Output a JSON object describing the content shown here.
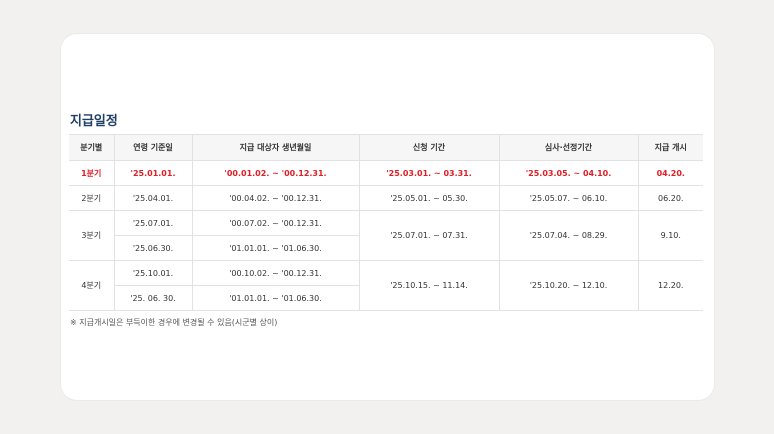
{
  "section_title": "지급일정",
  "table": {
    "headers": [
      "분기별",
      "연령 기준일",
      "지급 대상자 생년월일",
      "신청 기간",
      "심사·선정기간",
      "지급 개시"
    ],
    "q1": {
      "quarter": "1분기",
      "base_date": "'25.01.01.",
      "birth": "'00.01.02. ~ '00.12.31.",
      "apply": "'25.03.01. ~ 03.31.",
      "review": "'25.03.05. ~ 04.10.",
      "start": "04.20."
    },
    "q2": {
      "quarter": "2분기",
      "base_date": "'25.04.01.",
      "birth": "'00.04.02. ~ '00.12.31.",
      "apply": "'25.05.01. ~ 05.30.",
      "review": "'25.05.07. ~ 06.10.",
      "start": "06.20."
    },
    "q3": {
      "quarter": "3분기",
      "base_date_1": "'25.07.01.",
      "birth_1": "'00.07.02. ~ '00.12.31.",
      "base_date_2": "'25.06.30.",
      "birth_2": "'01.01.01. ~ '01.06.30.",
      "apply": "'25.07.01. ~ 07.31.",
      "review": "'25.07.04. ~ 08.29.",
      "start": "9.10."
    },
    "q4": {
      "quarter": "4분기",
      "base_date_1": "'25.10.01.",
      "birth_1": "'00.10.02. ~ '00.12.31.",
      "base_date_2": "'25. 06. 30.",
      "birth_2": "'01.01.01. ~ '01.06.30.",
      "apply": "'25.10.15. ~ 11.14.",
      "review": "'25.10.20. ~ 12.10.",
      "start": "12.20."
    }
  },
  "note": "※ 지급개시일은 부득이한 경우에 변경될 수 있음(시군별 상이)",
  "colors": {
    "title": "#1f3f67",
    "highlight": "#e11d24",
    "header_bg": "#f6f6f6",
    "card_bg": "#ffffff",
    "page_bg": "#f2f1ef"
  }
}
